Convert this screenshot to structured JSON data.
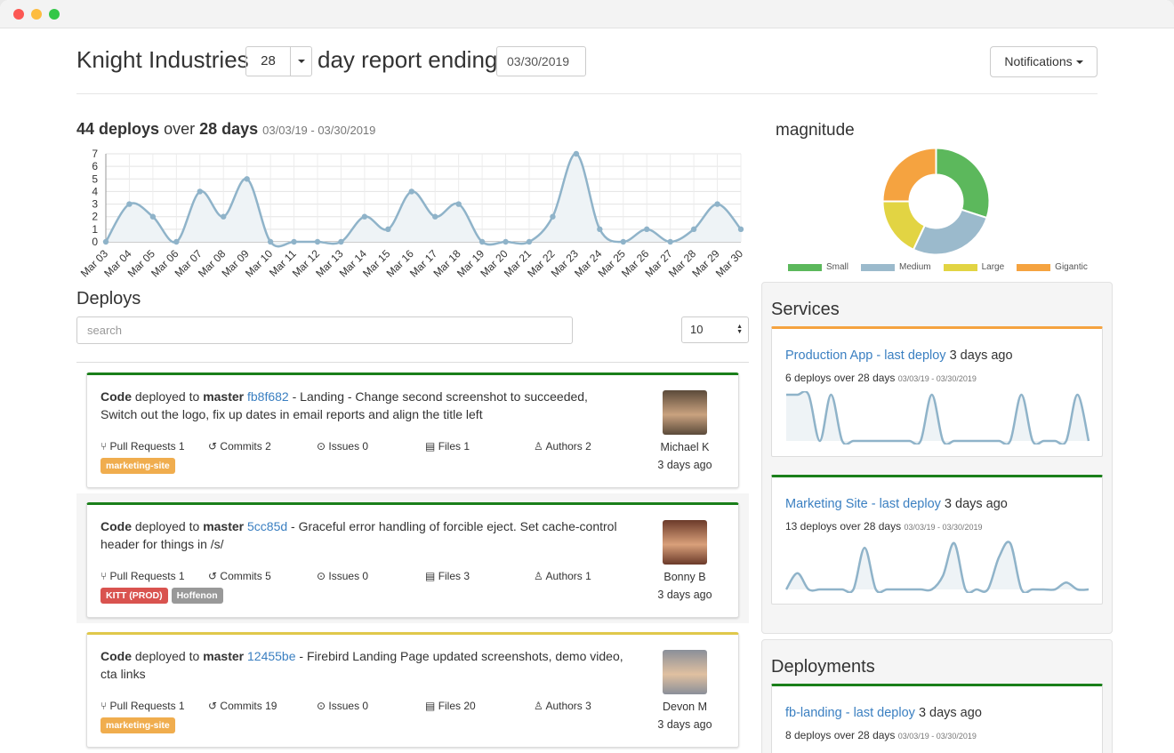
{
  "header": {
    "company": "Knight Industries",
    "days_value": "28",
    "day_text": "day report ending",
    "end_date": "03/30/2019",
    "notifications_label": "Notifications"
  },
  "summary": {
    "deploys_count": "44 deploys",
    "over_text": "over",
    "days_text": "28 days",
    "range": "03/03/19 - 03/30/2019"
  },
  "chart_data": [
    {
      "type": "area",
      "x": [
        "Mar 03",
        "Mar 04",
        "Mar 05",
        "Mar 06",
        "Mar 07",
        "Mar 08",
        "Mar 09",
        "Mar 10",
        "Mar 11",
        "Mar 12",
        "Mar 13",
        "Mar 14",
        "Mar 15",
        "Mar 16",
        "Mar 17",
        "Mar 18",
        "Mar 19",
        "Mar 20",
        "Mar 21",
        "Mar 22",
        "Mar 23",
        "Mar 24",
        "Mar 25",
        "Mar 26",
        "Mar 27",
        "Mar 28",
        "Mar 29",
        "Mar 30"
      ],
      "values": [
        0,
        3,
        2,
        0,
        4,
        2,
        5,
        0,
        0,
        0,
        0,
        2,
        1,
        4,
        2,
        3,
        0,
        0,
        0,
        2,
        7,
        1,
        0,
        1,
        0,
        1,
        3,
        1
      ],
      "yticks": [
        0,
        1,
        2,
        3,
        4,
        5,
        6,
        7
      ],
      "ylim": [
        0,
        7
      ],
      "grid": true,
      "color": "#8fb3c9"
    },
    {
      "type": "pie",
      "title": "magnitude",
      "labels": [
        "Small",
        "Medium",
        "Large",
        "Gigantic"
      ],
      "values": [
        30,
        27,
        18,
        25
      ],
      "colors": [
        "#5cb85c",
        "#9bbacc",
        "#e2d443",
        "#f5a340"
      ],
      "legend": "bottom"
    }
  ],
  "deploys": {
    "title": "Deploys",
    "search_placeholder": "search",
    "per_page": "10",
    "items": [
      {
        "code": "Code",
        "deployed_to": "deployed to",
        "branch": "master",
        "sha": "fb8f682",
        "message": " - Landing - Change second screenshot to succeeded, Switch out the logo, fix up dates in email reports and align the title left",
        "pull_requests": "Pull Requests 1",
        "commits": "Commits 2",
        "issues": "Issues 0",
        "files": "Files 1",
        "authors": "Authors 2",
        "tags": [
          {
            "label": "marketing-site",
            "color": "#f0ad4e"
          }
        ],
        "author": "Michael K",
        "time": "3 days ago"
      },
      {
        "code": "Code",
        "deployed_to": "deployed to",
        "branch": "master",
        "sha": "5cc85d",
        "message": " - Graceful error handling of forcible eject. Set cache-control header for things in /s/",
        "pull_requests": "Pull Requests 1",
        "commits": "Commits 5",
        "issues": "Issues 0",
        "files": "Files 3",
        "authors": "Authors 1",
        "tags": [
          {
            "label": "KITT (PROD)",
            "color": "#d9534f"
          },
          {
            "label": "Hoffenon",
            "color": "#999999"
          }
        ],
        "author": "Bonny B",
        "time": "3 days ago"
      },
      {
        "code": "Code",
        "deployed_to": "deployed to",
        "branch": "master",
        "sha": "12455be",
        "message": " - Firebird Landing Page updated screenshots, demo video, cta links",
        "pull_requests": "Pull Requests 1",
        "commits": "Commits 19",
        "issues": "Issues 0",
        "files": "Files 20",
        "authors": "Authors 3",
        "tags": [
          {
            "label": "marketing-site",
            "color": "#f0ad4e"
          }
        ],
        "author": "Devon M",
        "time": "3 days ago"
      }
    ]
  },
  "services": {
    "title": "Services",
    "items": [
      {
        "link": "Production App - last deploy",
        "ago": "3 days ago",
        "sub": "6 deploys over 28 days",
        "range": "03/03/19 - 03/30/2019"
      },
      {
        "link": "Marketing Site - last deploy",
        "ago": "3 days ago",
        "sub": "13 deploys over 28 days",
        "range": "03/03/19 - 03/30/2019"
      }
    ]
  },
  "deployments": {
    "title": "Deployments",
    "items": [
      {
        "link": "fb-landing - last deploy",
        "ago": "3 days ago",
        "sub": "8 deploys over 28 days",
        "range": "03/03/19 - 03/30/2019"
      }
    ]
  }
}
